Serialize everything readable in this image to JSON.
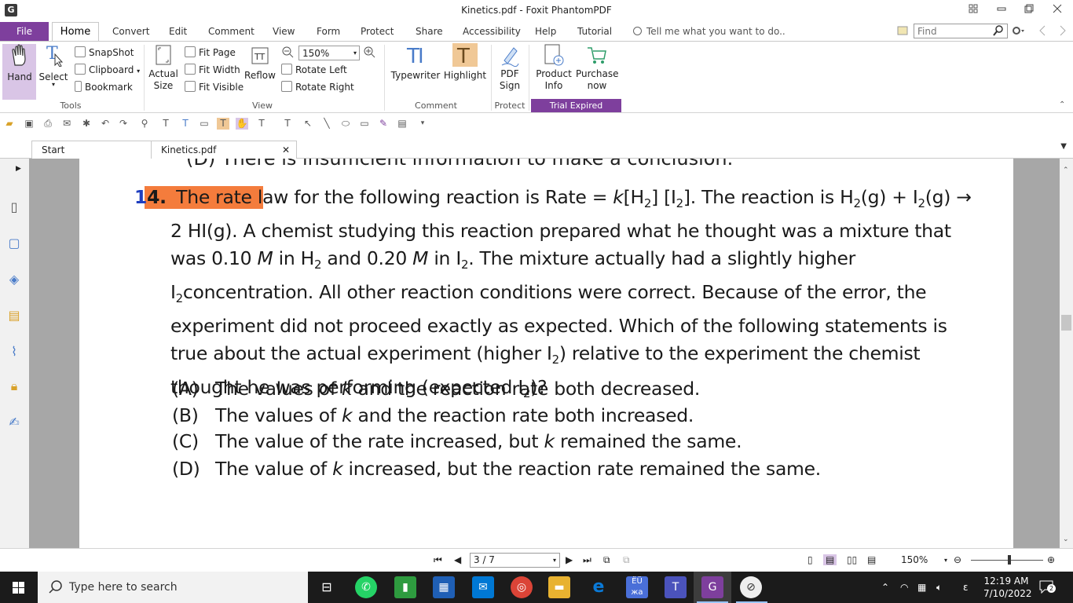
{
  "window": {
    "title": "Kinetics.pdf - Foxit PhantomPDF",
    "logo": "G"
  },
  "menu": {
    "file": "File",
    "tabs": [
      "Home",
      "Convert",
      "Edit",
      "Comment",
      "View",
      "Form",
      "Protect",
      "Share",
      "Accessibility",
      "Help",
      "Tutorial"
    ],
    "tell_me": "Tell me what you want to do..",
    "find_placeholder": "Find"
  },
  "ribbon": {
    "tools": {
      "hand": "Hand",
      "select": "Select",
      "snapshot": "SnapShot",
      "clipboard": "Clipboard",
      "bookmark": "Bookmark",
      "label": "Tools"
    },
    "view": {
      "actual_size_1": "Actual",
      "actual_size_2": "Size",
      "fit_page": "Fit Page",
      "fit_width": "Fit Width",
      "fit_visible": "Fit Visible",
      "reflow": "Reflow",
      "zoom_value": "150%",
      "rotate_left": "Rotate Left",
      "rotate_right": "Rotate Right",
      "label": "View"
    },
    "comment": {
      "typewriter": "Typewriter",
      "highlight": "Highlight",
      "label": "Comment"
    },
    "protect": {
      "pdf_sign_1": "PDF",
      "pdf_sign_2": "Sign",
      "label": "Protect"
    },
    "trial": {
      "product_info_1": "Product",
      "product_info_2": "Info",
      "purchase_1": "Purchase",
      "purchase_2": "now",
      "label": "Trial Expired"
    }
  },
  "doc_tabs": {
    "start": "Start",
    "kinetics": "Kinetics.pdf"
  },
  "document": {
    "cut_line": "(D)    There is insufficient information to make a conclusion.",
    "question_number": "14.",
    "highlighted": "The rate l",
    "choices": {
      "a_label": "(A)",
      "a_text_1": "The values of ",
      "a_k": "k",
      "a_text_2": " and the reaction rate both decreased.",
      "b_label": "(B)",
      "b_text_1": "The values of ",
      "b_k": "k",
      "b_text_2": " and the reaction rate both increased.",
      "c_label": "(C)",
      "c_text_1": "The value of the rate increased, but ",
      "c_k": "k",
      "c_text_2": " remained the same.",
      "d_label": "(D)",
      "d_text_1": "The value of ",
      "d_k": "k",
      "d_text_2": " increased, but the reaction rate remained the same."
    }
  },
  "status": {
    "page": "3 / 7",
    "zoom": "150%"
  },
  "taskbar": {
    "search_placeholder": "Type here to search",
    "time": "12:19 AM",
    "date": "7/10/2022",
    "notifications": "2",
    "lang": "ε"
  },
  "colors": {
    "accent": "#7e3f9d",
    "highlight": "#f47c3c",
    "question_number": "#1f3fbf",
    "taskbar": "#1b1b1b"
  }
}
